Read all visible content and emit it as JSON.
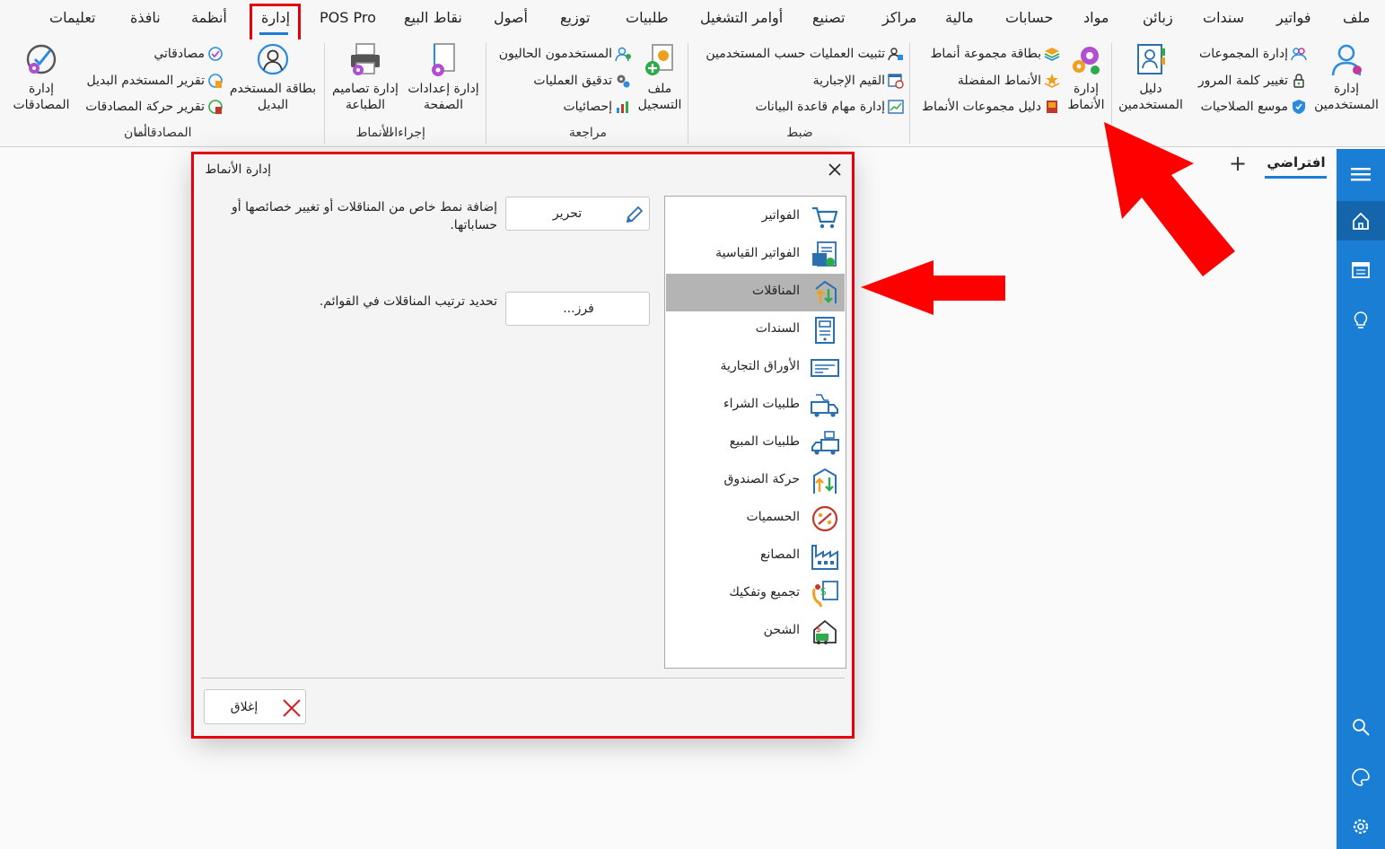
{
  "menu": {
    "items": [
      "ملف",
      "فواتير",
      "سندات",
      "زبائن",
      "مواد",
      "حسابات",
      "مالية",
      "مراكز",
      "تصنيع",
      "أوامر التشغيل",
      "طلبيات",
      "توزيع",
      "أصول",
      "نقاط البيع",
      "POS Pro",
      "إدارة",
      "أنظمة",
      "نافذة",
      "تعليمات"
    ],
    "active": "إدارة"
  },
  "ribbon": {
    "security": {
      "label": "أمان",
      "manage_users": "إدارة المستخدمين",
      "manage_groups": "إدارة المجموعات",
      "change_password": "تغيير كلمة المرور",
      "permissions_expander": "موسع الصلاحيات",
      "users_guide": "دليل المستخدمين"
    },
    "patterns": {
      "label": "الأنماط",
      "manage_patterns": "إدارة الأنماط",
      "pattern_group_card": "بطاقة مجموعة أنماط",
      "favorite_patterns": "الأنماط المفضلة",
      "pattern_groups_guide": "دليل مجموعات الأنماط"
    },
    "control": {
      "label": "ضبط",
      "lock_ops_by_users": "تثبيت العمليات حسب المستخدمين",
      "mandatory_values": "القيم الإجبارية",
      "db_tasks": "إدارة مهام قاعدة البيانات"
    },
    "review": {
      "label": "مراجعة",
      "log_file": "ملف التسجيل",
      "current_users": "المستخدمون الحاليون",
      "audit_operations": "تدقيق العمليات",
      "statistics": "إحصائيات"
    },
    "procedures": {
      "label": "إجراءات",
      "page_settings": "إدارة إعدادات الصفحة",
      "print_designs": "إدارة تصاميم الطباعة"
    },
    "approvals": {
      "label": "المصادقات",
      "substitute_user_card": "بطاقة المستخدم البديل",
      "my_approvals": "مصادقاتي",
      "substitute_user_report": "تقرير المستخدم البديل",
      "approvals_movement_report": "تقرير حركة المصادقات",
      "manage_approvals": "إدارة المصادقات"
    }
  },
  "tabs": {
    "current": "افتراضي",
    "add_symbol": "+"
  },
  "dialog": {
    "title": "إدارة الأنماط",
    "items": [
      {
        "label": "الفواتير",
        "icon": "cart-icon"
      },
      {
        "label": "الفواتير القياسية",
        "icon": "standard-invoice-icon"
      },
      {
        "label": "المناقلات",
        "icon": "transfers-icon"
      },
      {
        "label": "السندات",
        "icon": "voucher-icon"
      },
      {
        "label": "الأوراق التجارية",
        "icon": "check-icon"
      },
      {
        "label": "طلبيات الشراء",
        "icon": "purchase-truck-icon"
      },
      {
        "label": "طلبيات المبيع",
        "icon": "sales-truck-icon"
      },
      {
        "label": "حركة الصندوق",
        "icon": "cash-movement-icon"
      },
      {
        "label": "الحسميات",
        "icon": "discounts-icon"
      },
      {
        "label": "المصانع",
        "icon": "factory-icon"
      },
      {
        "label": "تجميع وتفكيك",
        "icon": "assembly-icon"
      },
      {
        "label": "الشحن",
        "icon": "shipping-icon"
      }
    ],
    "selected": "المناقلات",
    "edit_button": "تحرير",
    "edit_desc": "إضافة نمط خاص من المناقلات أو تغيير خصائصها أو حساباتها.",
    "sort_button": "فرز...",
    "sort_desc": "تحديد ترتيب المناقلات في القوائم.",
    "close_button": "إغلاق"
  },
  "colors": {
    "accent": "#1a7fd4",
    "annotation_red": "#e3000f",
    "selected_item": "#b4b4b4"
  }
}
